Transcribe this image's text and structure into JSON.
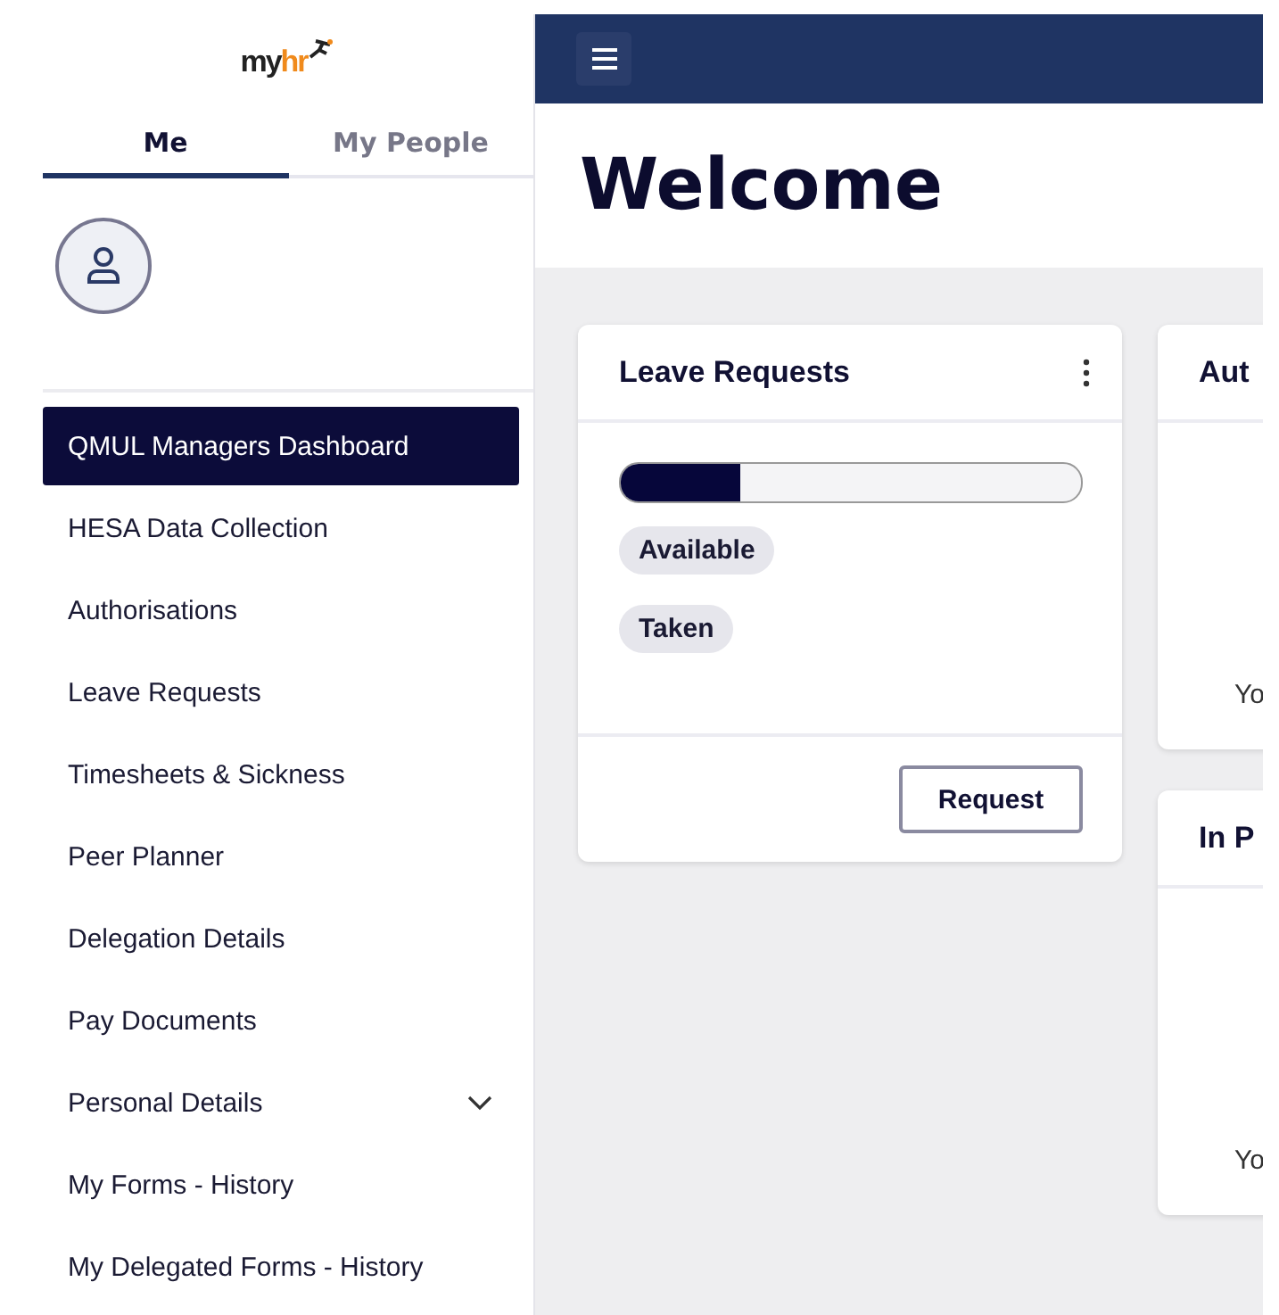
{
  "logo": {
    "parts": [
      "my",
      "hr"
    ]
  },
  "tabs": [
    {
      "label": "Me",
      "selected": true
    },
    {
      "label": "My People",
      "selected": false
    }
  ],
  "nav": [
    {
      "label": "QMUL Managers Dashboard",
      "selected": true
    },
    {
      "label": "HESA Data Collection",
      "selected": false
    },
    {
      "label": "Authorisations",
      "selected": false
    },
    {
      "label": "Leave Requests",
      "selected": false
    },
    {
      "label": "Timesheets & Sickness",
      "selected": false
    },
    {
      "label": "Peer Planner",
      "selected": false
    },
    {
      "label": "Delegation Details",
      "selected": false
    },
    {
      "label": "Pay Documents",
      "selected": false
    },
    {
      "label": "Personal Details",
      "selected": false,
      "expanded": false
    },
    {
      "label": "My Forms - History",
      "selected": false
    },
    {
      "label": "My Delegated Forms - History",
      "selected": false
    }
  ],
  "page_title": "Welcome",
  "leave_card": {
    "title": "Leave Requests",
    "level": 0.26,
    "chips": [
      "Available",
      "Taken"
    ],
    "button": "Request"
  },
  "side_cards": [
    {
      "title": "Aut",
      "footer": "Yo"
    },
    {
      "title": "In P",
      "footer": "Yo"
    }
  ]
}
